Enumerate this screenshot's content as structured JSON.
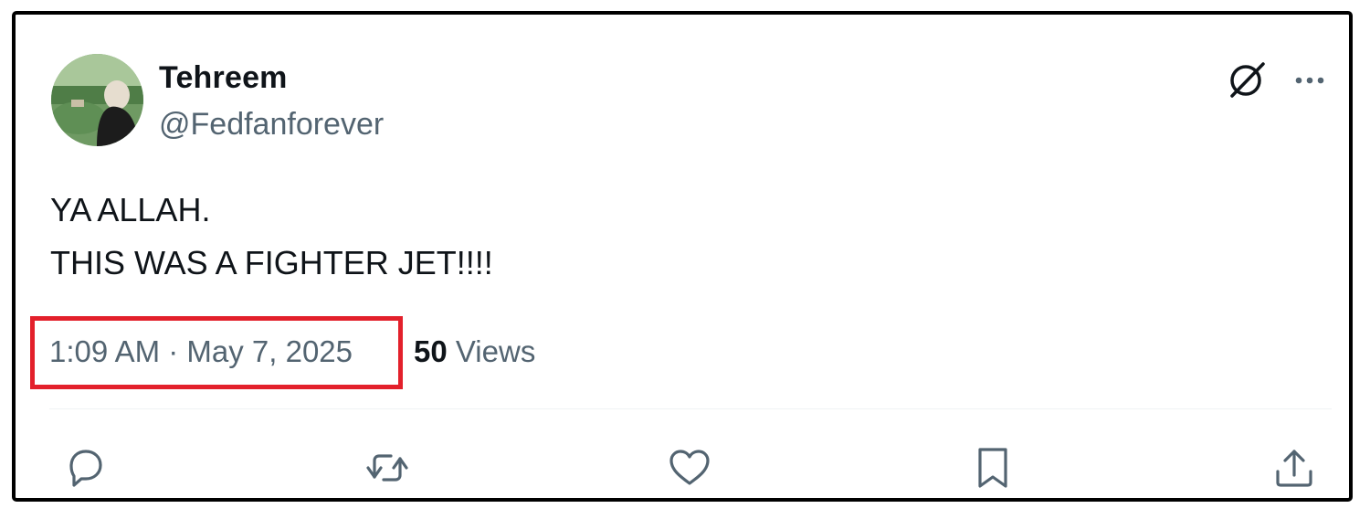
{
  "tweet": {
    "author": {
      "display_name": "Tehreem",
      "handle": "@Fedfanforever"
    },
    "text_lines": [
      "YA ALLAH.",
      "THIS WAS A FIGHTER JET!!!!"
    ],
    "timestamp": "1:09 AM · May 7, 2025",
    "views_count": "50",
    "views_label": "Views"
  },
  "icons": {
    "header": [
      "grok-icon",
      "more-icon"
    ],
    "actions": [
      "reply-icon",
      "retweet-icon",
      "like-icon",
      "bookmark-icon",
      "share-icon"
    ]
  },
  "colors": {
    "primary_text": "#0f1419",
    "secondary_text": "#536471",
    "highlight_border": "#e3202b",
    "frame_border": "#000000"
  }
}
